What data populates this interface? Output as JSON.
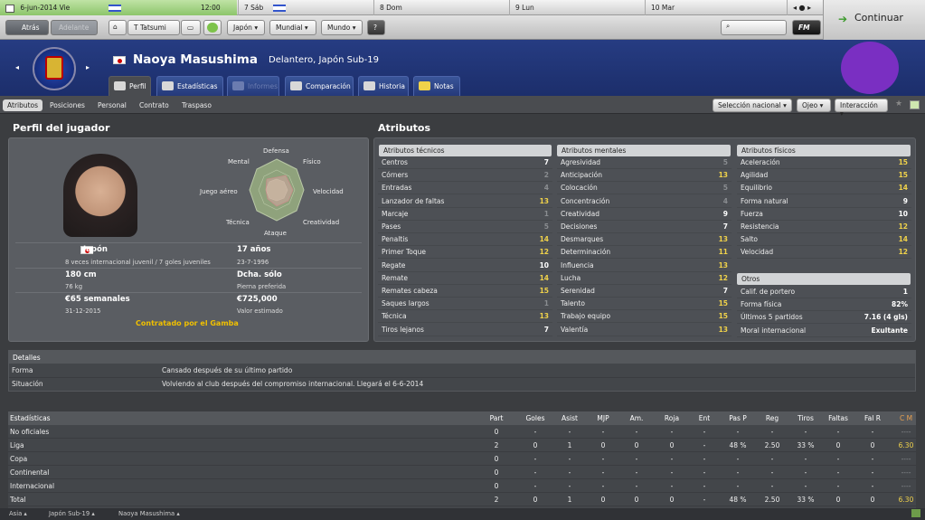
{
  "topbar": {
    "date": "6-jun-2014 Vie",
    "time": "12:00",
    "days": [
      "7 Sáb",
      "8 Dom",
      "9 Lun",
      "10 Mar"
    ],
    "continue_label": "Continuar"
  },
  "nav": {
    "back": "Atrás",
    "forward": "Adelante",
    "manager": "T Tatsumi",
    "japan": "Japón",
    "world_menu": "Mundial",
    "mundo": "Mundo",
    "help": "?",
    "fm": "FM"
  },
  "player": {
    "name": "Naoya Masushima",
    "position": "Delantero, Japón Sub-19"
  },
  "tabs": [
    "Perfil",
    "Estadísticas",
    "Informes",
    "Comparación",
    "Historia",
    "Notas"
  ],
  "subtabs": [
    "Atributos",
    "Posiciones",
    "Personal",
    "Contrato",
    "Traspaso"
  ],
  "actions": {
    "seleccion": "Selección nacional",
    "ojeo": "Ojeo",
    "interaccion": "Interacción"
  },
  "profile": {
    "title": "Perfil del jugador",
    "radar_labels": {
      "defensa": "Defensa",
      "fisico": "Físico",
      "mental": "Mental",
      "velocidad": "Velocidad",
      "juego_aereo": "Juego aéreo",
      "creatividad": "Creatividad",
      "tecnica": "Técnica",
      "ataque": "Ataque"
    },
    "nationality": "Japón",
    "caps": "8 veces internacional juvenil / 7 goles juveniles",
    "age": "17 años",
    "dob": "23-7-1996",
    "height": "180 cm",
    "weight": "76 kg",
    "foot": "Dcha. sólo",
    "foot_label": "Pierna preferida",
    "wage": "€65 semanales",
    "contract_end": "31-12-2015",
    "value": "€725,000",
    "value_label": "Valor estimado",
    "contracted": "Contratado por el Gamba"
  },
  "attributes": {
    "title": "Atributos",
    "technical_title": "Atributos técnicos",
    "mental_title": "Atributos mentales",
    "physical_title": "Atributos físicos",
    "others_title": "Otros",
    "technical": [
      {
        "name": "Centros",
        "value": "7"
      },
      {
        "name": "Córners",
        "value": "2"
      },
      {
        "name": "Entradas",
        "value": "4"
      },
      {
        "name": "Lanzador de faltas",
        "value": "13"
      },
      {
        "name": "Marcaje",
        "value": "1"
      },
      {
        "name": "Pases",
        "value": "5"
      },
      {
        "name": "Penaltis",
        "value": "14"
      },
      {
        "name": "Primer Toque",
        "value": "12"
      },
      {
        "name": "Regate",
        "value": "10"
      },
      {
        "name": "Remate",
        "value": "14"
      },
      {
        "name": "Remates cabeza",
        "value": "15"
      },
      {
        "name": "Saques largos",
        "value": "1"
      },
      {
        "name": "Técnica",
        "value": "13"
      },
      {
        "name": "Tiros lejanos",
        "value": "7"
      }
    ],
    "mental": [
      {
        "name": "Agresividad",
        "value": "5"
      },
      {
        "name": "Anticipación",
        "value": "13"
      },
      {
        "name": "Colocación",
        "value": "5"
      },
      {
        "name": "Concentración",
        "value": "4"
      },
      {
        "name": "Creatividad",
        "value": "9"
      },
      {
        "name": "Decisiones",
        "value": "7"
      },
      {
        "name": "Desmarques",
        "value": "13"
      },
      {
        "name": "Determinación",
        "value": "11"
      },
      {
        "name": "Influencia",
        "value": "13"
      },
      {
        "name": "Lucha",
        "value": "12"
      },
      {
        "name": "Serenidad",
        "value": "7"
      },
      {
        "name": "Talento",
        "value": "15"
      },
      {
        "name": "Trabajo equipo",
        "value": "15"
      },
      {
        "name": "Valentía",
        "value": "13"
      }
    ],
    "physical": [
      {
        "name": "Aceleración",
        "value": "15"
      },
      {
        "name": "Agilidad",
        "value": "15"
      },
      {
        "name": "Equilibrio",
        "value": "14"
      },
      {
        "name": "Forma natural",
        "value": "9"
      },
      {
        "name": "Fuerza",
        "value": "10"
      },
      {
        "name": "Resistencia",
        "value": "12"
      },
      {
        "name": "Salto",
        "value": "14"
      },
      {
        "name": "Velocidad",
        "value": "12"
      }
    ],
    "others": [
      {
        "name": "Calif. de portero",
        "value": "1"
      },
      {
        "name": "Forma física",
        "value": "82%"
      },
      {
        "name": "Últimos 5 partidos",
        "value": "7.16 (4 gls)"
      },
      {
        "name": "Moral internacional",
        "value": "Exultante"
      }
    ]
  },
  "details": {
    "title": "Detalles",
    "rows": [
      {
        "label": "Forma",
        "value": "Cansado después de su último partido"
      },
      {
        "label": "Situación",
        "value": "Volviendo al club después del compromiso internacional. Llegará el 6-6-2014"
      }
    ]
  },
  "stats": {
    "title": "Estadísticas",
    "columns": [
      "Part",
      "Goles",
      "Asist",
      "MJP",
      "Am.",
      "Roja",
      "Ent",
      "Pas P",
      "Reg",
      "Tiros",
      "Faltas",
      "Fal R",
      "C M"
    ],
    "rows": [
      {
        "name": "No oficiales",
        "values": [
          "0",
          "-",
          "-",
          "-",
          "-",
          "-",
          "-",
          "-",
          "-",
          "-",
          "-",
          "-",
          "----"
        ]
      },
      {
        "name": "Liga",
        "values": [
          "2",
          "0",
          "1",
          "0",
          "0",
          "0",
          "-",
          "48 %",
          "2.50",
          "33 %",
          "0",
          "0",
          "6.30"
        ]
      },
      {
        "name": "Copa",
        "values": [
          "0",
          "-",
          "-",
          "-",
          "-",
          "-",
          "-",
          "-",
          "-",
          "-",
          "-",
          "-",
          "----"
        ]
      },
      {
        "name": "Continental",
        "values": [
          "0",
          "-",
          "-",
          "-",
          "-",
          "-",
          "-",
          "-",
          "-",
          "-",
          "-",
          "-",
          "----"
        ]
      },
      {
        "name": "Internacional",
        "values": [
          "0",
          "-",
          "-",
          "-",
          "-",
          "-",
          "-",
          "-",
          "-",
          "-",
          "-",
          "-",
          "----"
        ]
      },
      {
        "name": "Total",
        "values": [
          "2",
          "0",
          "1",
          "0",
          "0",
          "0",
          "-",
          "48 %",
          "2.50",
          "33 %",
          "0",
          "0",
          "6.30"
        ]
      }
    ]
  },
  "footer": {
    "crumbs": [
      "Asia",
      "Japón Sub-19",
      "Naoya Masushima"
    ]
  },
  "colors": {
    "accent_yellow": "#f0d24a",
    "header_blue": "#263c82",
    "continue_green": "#3b9a2b"
  }
}
